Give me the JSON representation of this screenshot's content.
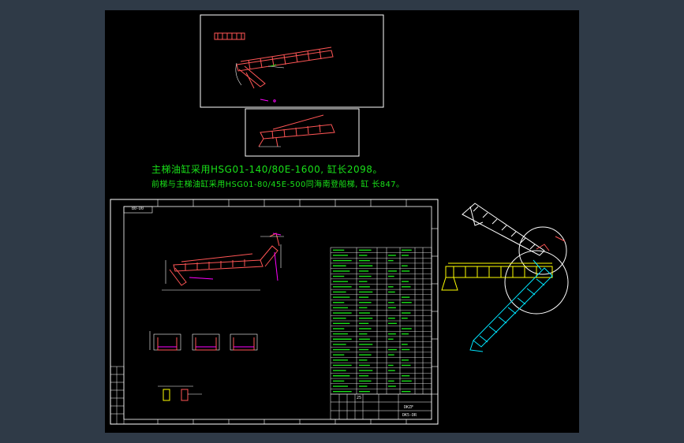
{
  "drawing": {
    "background": "#000000",
    "viewport_border": "#2f3a47",
    "note_color": "#19e019",
    "accent_magenta": "#ff00ff",
    "accent_yellow": "#ffff00",
    "accent_cyan": "#00e5ff"
  },
  "notes": {
    "line1": "主梯油缸采用HSG01-140/80E-1600, 缸长2098。",
    "line2": "前梯与主梯油缸采用HSG01-80/45E-500同海南登船梯, 缸      长847。"
  },
  "sheet": {
    "zone_label": "B0-D0",
    "title_block_code": "DKZF",
    "title_block_number": "DK5-DR",
    "title_block_mark": "25",
    "bom_row_count": 28
  }
}
